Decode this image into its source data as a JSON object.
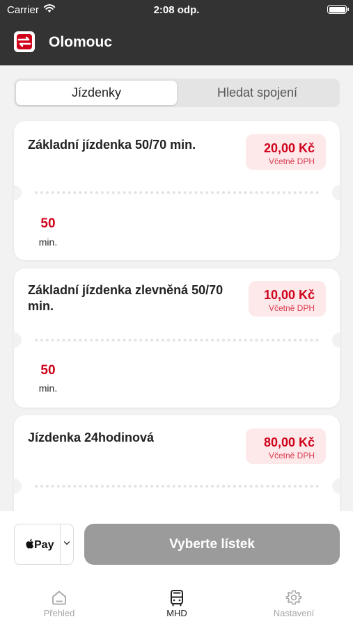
{
  "status_bar": {
    "carrier": "Carrier",
    "time": "2:08 odp."
  },
  "header": {
    "title": "Olomouc"
  },
  "segments": {
    "active": "Jízdenky",
    "inactive": "Hledat spojení"
  },
  "tickets": [
    {
      "name": "Základní jízdenka 50/70 min.",
      "price": "20,00 Kč",
      "vat": "Včetně DPH",
      "duration_value": "50",
      "duration_unit": "min."
    },
    {
      "name": "Základní jízdenka zlevněná 50/70 min.",
      "price": "10,00 Kč",
      "vat": "Včetně DPH",
      "duration_value": "50",
      "duration_unit": "min."
    },
    {
      "name": "Jízdenka 24hodinová",
      "price": "80,00 Kč",
      "vat": "Včetně DPH"
    }
  ],
  "payment": {
    "method": "Pay",
    "button_label": "Vyberte lístek"
  },
  "tabs": [
    {
      "label": "Přehled",
      "icon": "home-icon",
      "active": false
    },
    {
      "label": "MHD",
      "icon": "bus-icon",
      "active": true
    },
    {
      "label": "Nastavení",
      "icon": "gear-icon",
      "active": false
    }
  ],
  "colors": {
    "accent": "#d0021b",
    "header_bg": "#333333",
    "button_disabled": "#9b9b9b",
    "price_bg": "#fde8ea"
  }
}
